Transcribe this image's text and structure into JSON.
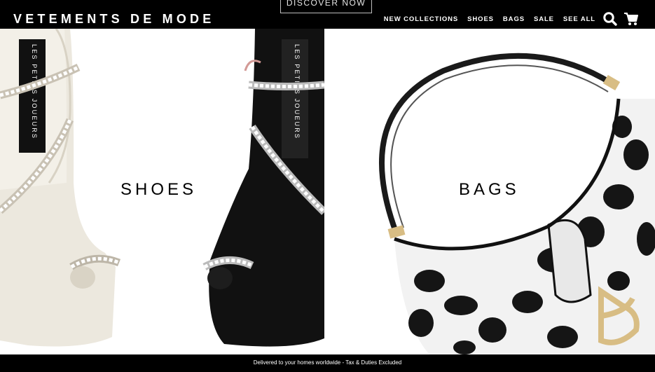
{
  "header": {
    "brand": "VETEMENTS DE MODE",
    "discover_label": "DISCOVER NOW",
    "nav": [
      "NEW COLLECTIONS",
      "SHOES",
      "BAGS",
      "SALE",
      "SEE ALL"
    ],
    "icons": [
      "search-icon",
      "cart-icon"
    ]
  },
  "hero": {
    "shoes": {
      "title": "SHOES",
      "label_text": "LES PETITS JOUEURS"
    },
    "bags": {
      "title": "BAGS"
    }
  },
  "footer": {
    "text": "Delivered to your homes worldwide - Tax & Duties Excluded"
  },
  "colors": {
    "bar": "#000000",
    "cream_shoe": "#ece8de",
    "black_shoe": "#111111",
    "gold": "#d8bd84"
  }
}
